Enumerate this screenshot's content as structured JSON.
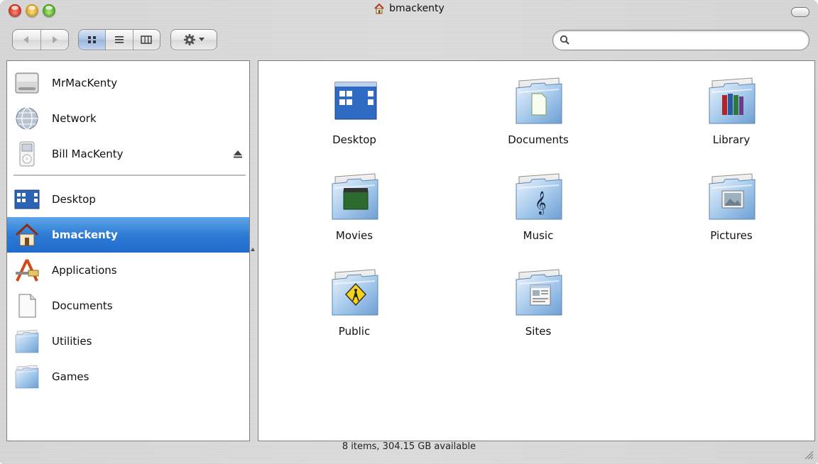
{
  "window": {
    "title": "bmackenty",
    "status_text": "8 items, 304.15 GB available"
  },
  "toolbar": {
    "view_modes": [
      "icon-view",
      "list-view",
      "column-view"
    ],
    "active_view": "icon-view",
    "search_placeholder": ""
  },
  "sidebar": {
    "devices": [
      {
        "label": "MrMacKenty",
        "icon": "hard-drive-icon"
      },
      {
        "label": "Network",
        "icon": "network-globe-icon"
      },
      {
        "label": "Bill MacKenty",
        "icon": "ipod-icon",
        "ejectable": true
      }
    ],
    "places": [
      {
        "label": "Desktop",
        "icon": "desktop-icon"
      },
      {
        "label": "bmackenty",
        "icon": "home-icon",
        "selected": true
      },
      {
        "label": "Applications",
        "icon": "applications-icon"
      },
      {
        "label": "Documents",
        "icon": "document-icon"
      },
      {
        "label": "Utilities",
        "icon": "folder-icon"
      },
      {
        "label": "Games",
        "icon": "folder-icon"
      }
    ]
  },
  "main": {
    "items": [
      {
        "label": "Desktop",
        "icon": "desktop-folder-icon"
      },
      {
        "label": "Documents",
        "icon": "documents-folder-icon"
      },
      {
        "label": "Library",
        "icon": "library-folder-icon"
      },
      {
        "label": "Movies",
        "icon": "movies-folder-icon"
      },
      {
        "label": "Music",
        "icon": "music-folder-icon"
      },
      {
        "label": "Pictures",
        "icon": "pictures-folder-icon"
      },
      {
        "label": "Public",
        "icon": "public-folder-icon"
      },
      {
        "label": "Sites",
        "icon": "sites-folder-icon"
      }
    ]
  },
  "colors": {
    "selection": "#2e7bd6",
    "folder_blue": "#9cc3ea"
  }
}
